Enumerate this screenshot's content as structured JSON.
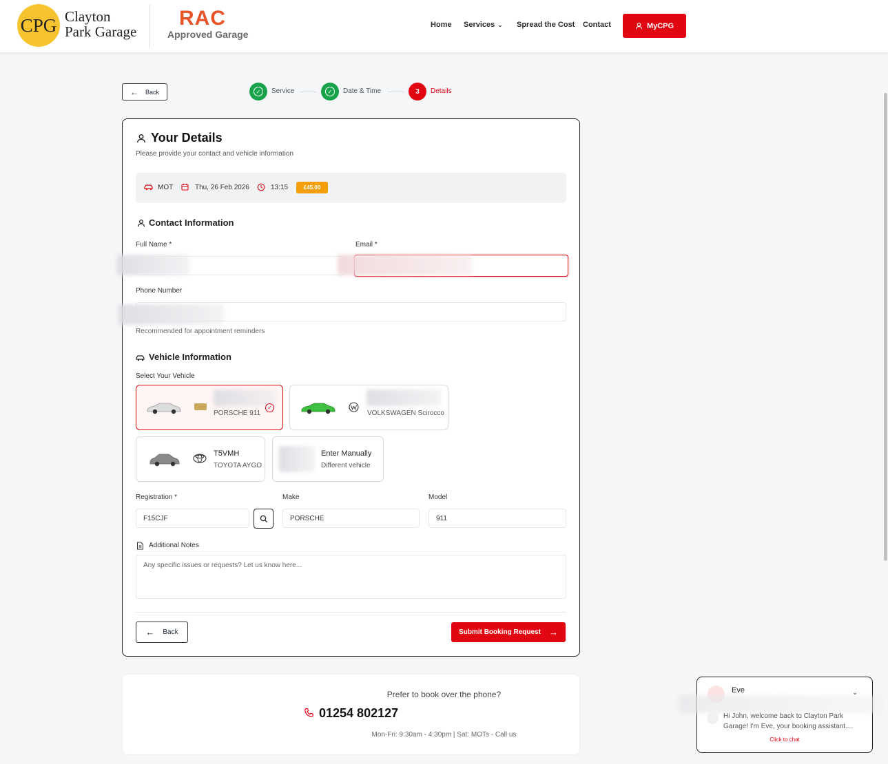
{
  "header": {
    "logo_initials": "CPG",
    "logo_line1": "Clayton",
    "logo_line2": "Park Garage",
    "rac_mark": "RAC",
    "rac_sub": "Approved Garage",
    "nav": [
      "Home",
      "Services",
      "Spread the Cost",
      "Contact"
    ],
    "mycpg_label": "MyCPG"
  },
  "steps": {
    "back_label": "Back",
    "items": [
      {
        "label": "Service",
        "state": "done"
      },
      {
        "label": "Date & Time",
        "state": "done"
      },
      {
        "label": "Details",
        "state": "active",
        "number": "3"
      }
    ]
  },
  "details": {
    "title": "Your Details",
    "subtitle": "Please provide your contact and vehicle information",
    "summary": {
      "service": "MOT",
      "date": "Thu, 26 Feb 2026",
      "time": "13:15",
      "price": "£45.00"
    }
  },
  "contact": {
    "title": "Contact Information",
    "full_name_label": "Full Name *",
    "email_label": "Email *",
    "phone_label": "Phone Number",
    "phone_hint": "Recommended for appointment reminders"
  },
  "vehicle": {
    "title": "Vehicle Information",
    "select_label": "Select Your Vehicle",
    "cards": [
      {
        "reg": "",
        "name": "PORSCHE 911",
        "color": "#d9d9d9",
        "selected": true
      },
      {
        "reg": "",
        "name": "VOLKSWAGEN Scirocco",
        "color": "#3fbf3f",
        "selected": false
      },
      {
        "reg": "T5VMH",
        "name": "TOYOTA AYGO",
        "color": "#8a8a8a",
        "selected": false
      }
    ],
    "manual_title": "Enter Manually",
    "manual_sub": "Different vehicle",
    "registration_label": "Registration *",
    "registration_value": "F15CJF",
    "make_label": "Make",
    "make_value": "PORSCHE",
    "model_label": "Model",
    "model_value": "911",
    "notes_label": "Additional Notes",
    "notes_placeholder": "Any specific issues or requests? Let us know here..."
  },
  "actions": {
    "back_label": "Back",
    "submit_label": "Submit Booking Request"
  },
  "phone": {
    "question": "Prefer to book over the phone?",
    "number": "01254 802127",
    "hours": "Mon-Fri: 9:30am - 4:30pm | Sat: MOTs - Call us"
  },
  "chat": {
    "name": "Eve",
    "message": "Hi John, welcome back to Clayton Park Garage! I'm Eve, your booking assistant....",
    "cta": "Click to chat"
  },
  "colors": {
    "brand_red": "#e20613",
    "success_green": "#16a34a",
    "price_badge": "#f59e0b",
    "logo_yellow": "#f7c32e"
  }
}
